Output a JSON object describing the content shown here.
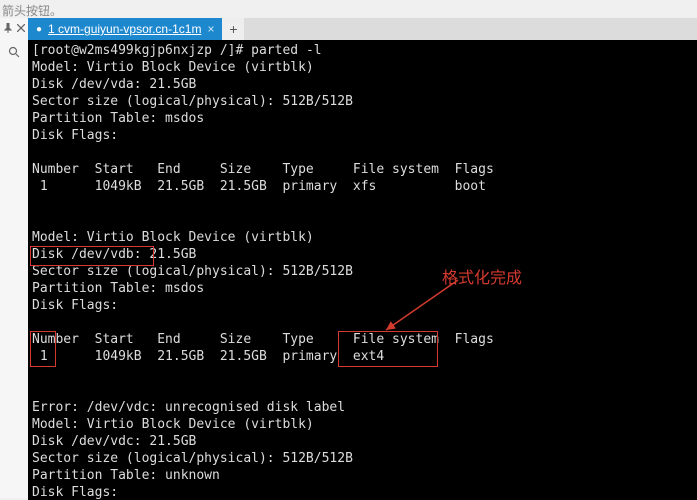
{
  "instruction_text": "箭头按钮。",
  "tab": {
    "title": "1 cvm-guiyun-vpsor.cn-1c1m",
    "active_indicator": "●"
  },
  "terminal": {
    "prompt": "[root@w2ms499kgjp6nxjzp /]# ",
    "command": "parted -l",
    "lines_vda": [
      "Model: Virtio Block Device (virtblk)",
      "Disk /dev/vda: 21.5GB",
      "Sector size (logical/physical): 512B/512B",
      "Partition Table: msdos",
      "Disk Flags:",
      "",
      "Number  Start   End     Size    Type     File system  Flags",
      " 1      1049kB  21.5GB  21.5GB  primary  xfs          boot",
      "",
      ""
    ],
    "lines_vdb": [
      "Model: Virtio Block Device (virtblk)",
      "Disk /dev/vdb: 21.5GB",
      "Sector size (logical/physical): 512B/512B",
      "Partition Table: msdos",
      "Disk Flags:",
      "",
      "Number  Start   End     Size    Type     File system  Flags",
      " 1      1049kB  21.5GB  21.5GB  primary  ext4",
      "",
      ""
    ],
    "lines_vdc": [
      "Error: /dev/vdc: unrecognised disk label",
      "Model: Virtio Block Device (virtblk)",
      "Disk /dev/vdc: 21.5GB",
      "Sector size (logical/physical): 512B/512B",
      "Partition Table: unknown",
      "Disk Flags:"
    ]
  },
  "annotation": {
    "label": "格式化完成"
  },
  "chart_data": {
    "type": "table",
    "title": "parted -l output",
    "devices": [
      {
        "path": "/dev/vda",
        "model": "Virtio Block Device (virtblk)",
        "size": "21.5GB",
        "sector_size": "512B/512B",
        "partition_table": "msdos",
        "partitions": [
          {
            "number": 1,
            "start": "1049kB",
            "end": "21.5GB",
            "size": "21.5GB",
            "type": "primary",
            "file_system": "xfs",
            "flags": "boot"
          }
        ]
      },
      {
        "path": "/dev/vdb",
        "model": "Virtio Block Device (virtblk)",
        "size": "21.5GB",
        "sector_size": "512B/512B",
        "partition_table": "msdos",
        "partitions": [
          {
            "number": 1,
            "start": "1049kB",
            "end": "21.5GB",
            "size": "21.5GB",
            "type": "primary",
            "file_system": "ext4",
            "flags": ""
          }
        ],
        "annotation": "格式化完成"
      },
      {
        "path": "/dev/vdc",
        "model": "Virtio Block Device (virtblk)",
        "size": "21.5GB",
        "sector_size": "512B/512B",
        "partition_table": "unknown",
        "error": "unrecognised disk label",
        "partitions": []
      }
    ]
  }
}
